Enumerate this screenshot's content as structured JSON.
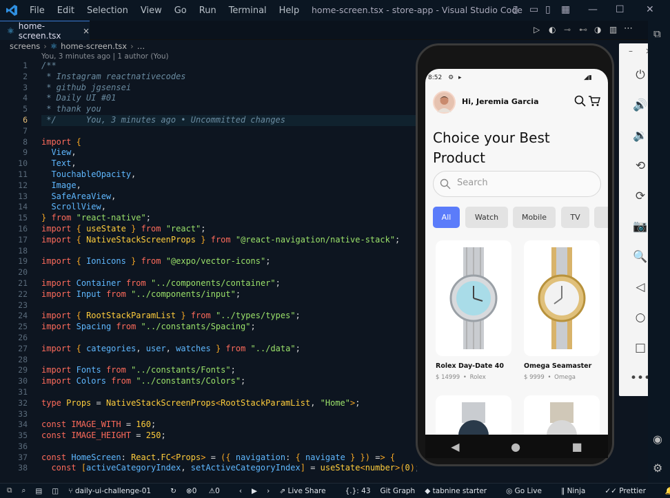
{
  "window": {
    "title": "home-screen.tsx - store-app - Visual Studio Code",
    "menu": [
      "File",
      "Edit",
      "Selection",
      "View",
      "Go",
      "Run",
      "Terminal",
      "Help"
    ]
  },
  "tab": {
    "label": "home-screen.tsx"
  },
  "breadcrumb": {
    "folder": "screens",
    "file": "home-screen.tsx",
    "tail": "…"
  },
  "blame": "You, 3 minutes ago | 1 author (You)",
  "lines": {
    "numbers": [
      "1",
      "2",
      "3",
      "4",
      "5",
      "6",
      "7",
      "8",
      "9",
      "10",
      "11",
      "12",
      "13",
      "14",
      "15",
      "16",
      "17",
      "18",
      "19",
      "20",
      "21",
      "22",
      "23",
      "24",
      "25",
      "26",
      "27",
      "28",
      "29",
      "30",
      "31",
      "32",
      "33",
      "34",
      "35",
      "36",
      "37",
      "38"
    ],
    "active": "6",
    "code": [
      "/**",
      " * Instagram reactnativecodes",
      " * github jgsensei",
      " * Daily UI #01",
      " * thank you",
      " */      You, 3 minutes ago • Uncommitted changes",
      "",
      "import {",
      "  View,",
      "  Text,",
      "  TouchableOpacity,",
      "  Image,",
      "  SafeAreaView,",
      "  ScrollView,",
      "} from \"react-native\";",
      "import { useState } from \"react\";",
      "import { NativeStackScreenProps } from \"@react-navigation/native-stack\";",
      "",
      "import { Ionicons } from \"@expo/vector-icons\";",
      "",
      "import Container from \"../components/container\";",
      "import Input from \"../components/input\";",
      "",
      "import { RootStackParamList } from \"../types/types\";",
      "import Spacing from \"../constants/Spacing\";",
      "",
      "import { categories, user, watches } from \"../data\";",
      "",
      "import Fonts from \"../constants/Fonts\";",
      "import Colors from \"../constants/Colors\";",
      "",
      "type Props = NativeStackScreenProps<RootStackParamList, \"Home\">;",
      "",
      "const IMAGE_WITH = 160;",
      "const IMAGE_HEIGHT = 250;",
      "",
      "const HomeScreen: React.FC<Props> = ({ navigation: { navigate } }) => {",
      "  const [activeCategoryIndex, setActiveCategoryIndex] = useState<number>(0);"
    ]
  },
  "app": {
    "time": "8:52",
    "greeting": "Hi, Jeremia Garcia",
    "heading": "Choice your Best Product",
    "search_placeholder": "Search",
    "categories": [
      "All",
      "Watch",
      "Mobile",
      "TV"
    ],
    "products": [
      {
        "name": "Rolex Day-Date 40",
        "price": "$ 14999",
        "brand": "Rolex"
      },
      {
        "name": "Omega Seamaster",
        "price": "$ 9999",
        "brand": "Omega"
      }
    ]
  },
  "status": {
    "branch": "daily-ui-challenge-01",
    "errors": "0",
    "warnings": "0",
    "live_share": "Live Share",
    "position": "{.}: 43",
    "git_graph": "Git Graph",
    "tabnine": "tabnine starter",
    "go_live": "Go Live",
    "ninja": "Ninja",
    "prettier": "Prettier"
  },
  "colors": {
    "accent": "#5b7cfa",
    "keyword": "#ff6b5b",
    "function": "#5fb8ff",
    "string": "#9be26a"
  }
}
